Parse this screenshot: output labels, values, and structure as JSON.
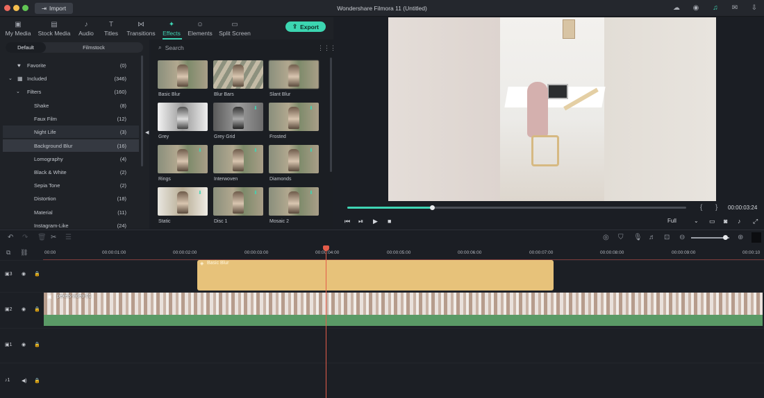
{
  "titlebar": {
    "import_label": "Import",
    "app_title": "Wondershare Filmora 11 (Untitled)",
    "icons": [
      "cloud-icon",
      "account-icon",
      "support-icon",
      "mail-icon",
      "download-icon"
    ]
  },
  "tabs": [
    {
      "label": "My Media",
      "icon": "my-media-icon"
    },
    {
      "label": "Stock Media",
      "icon": "stock-media-icon"
    },
    {
      "label": "Audio",
      "icon": "audio-icon"
    },
    {
      "label": "Titles",
      "icon": "titles-icon"
    },
    {
      "label": "Transitions",
      "icon": "transitions-icon"
    },
    {
      "label": "Effects",
      "icon": "effects-icon",
      "active": true
    },
    {
      "label": "Elements",
      "icon": "elements-icon"
    },
    {
      "label": "Split Screen",
      "icon": "split-screen-icon"
    }
  ],
  "export_label": "Export",
  "library": {
    "toggle": {
      "default": "Default",
      "filmstock": "Filmstock"
    },
    "items": [
      {
        "label": "Favorite",
        "count": "(0)"
      },
      {
        "label": "Included",
        "count": "(346)"
      },
      {
        "label": "Filters",
        "count": "(160)"
      },
      {
        "label": "Shake",
        "count": "(8)"
      },
      {
        "label": "Faux Film",
        "count": "(12)"
      },
      {
        "label": "Night Life",
        "count": "(3)"
      },
      {
        "label": "Background Blur",
        "count": "(16)"
      },
      {
        "label": "Lomography",
        "count": "(4)"
      },
      {
        "label": "Black & White",
        "count": "(2)"
      },
      {
        "label": "Sepia Tone",
        "count": "(2)"
      },
      {
        "label": "Distortion",
        "count": "(18)"
      },
      {
        "label": "Material",
        "count": "(11)"
      },
      {
        "label": "Instagram-Like",
        "count": "(24)"
      }
    ]
  },
  "search": {
    "placeholder": "Search"
  },
  "effects": [
    {
      "label": "Basic Blur"
    },
    {
      "label": "Blur Bars"
    },
    {
      "label": "Slant Blur"
    },
    {
      "label": "Grey"
    },
    {
      "label": "Grey Grid"
    },
    {
      "label": "Frosted"
    },
    {
      "label": "Rings"
    },
    {
      "label": "Interwoven"
    },
    {
      "label": "Diamonds"
    },
    {
      "label": "Static"
    },
    {
      "label": "Disc 1"
    },
    {
      "label": "Mosaic 2"
    }
  ],
  "preview": {
    "timecode": "00:00:03:24",
    "progress": 0.25,
    "quality": "Full"
  },
  "timeline": {
    "ticks": [
      "00:00",
      "00:00:01:00",
      "00:00:02:00",
      "00:00:03:00",
      "00:00:04:00",
      "00:00:05:00",
      "00:00:06:00",
      "00:00:07:00",
      "00:00:08:00",
      "00:00:09:00",
      "00:00:10"
    ],
    "tracks": [
      {
        "label": "3",
        "type": "video"
      },
      {
        "label": "2",
        "type": "video"
      },
      {
        "label": "1",
        "type": "video"
      },
      {
        "label": "1",
        "type": "audio"
      }
    ],
    "effect_clip_label": "Basic Blur",
    "video_clip_label": "pexels-video-01"
  }
}
